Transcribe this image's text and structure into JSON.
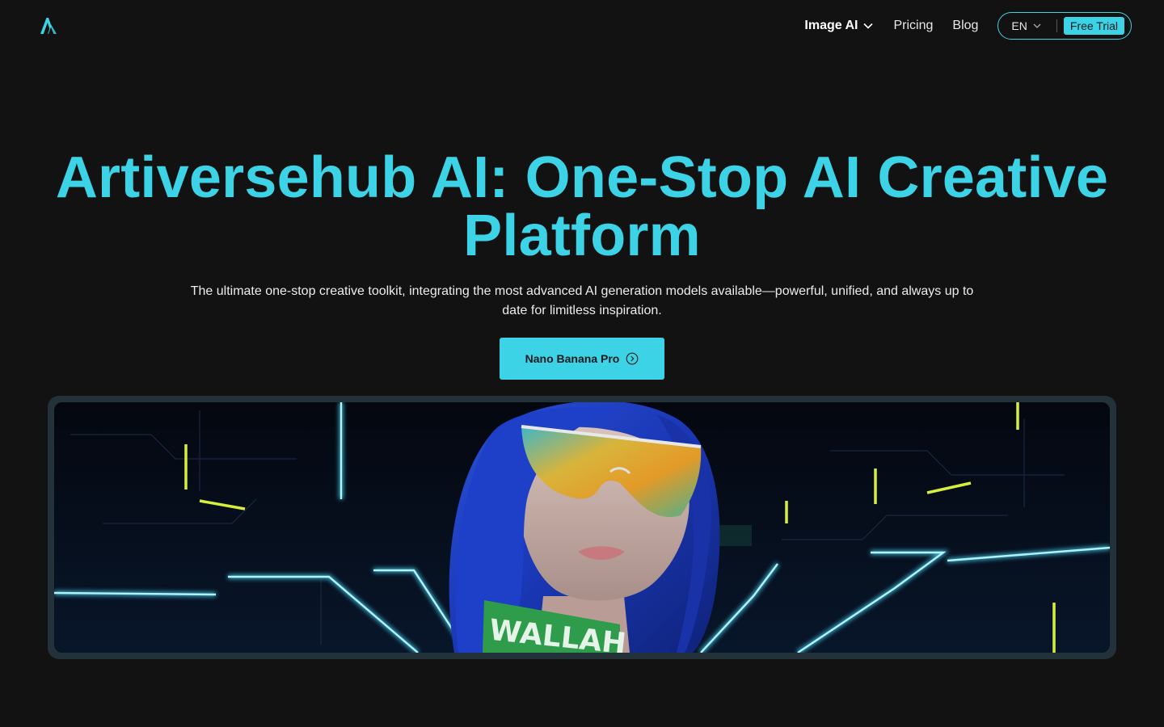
{
  "header": {
    "logo_icon": "artiversehub-logo-icon",
    "nav": {
      "image_ai_label": "Image AI",
      "pricing_label": "Pricing",
      "blog_label": "Blog"
    },
    "language": {
      "selected": "EN"
    },
    "free_trial_label": "Free Trial"
  },
  "hero": {
    "title": "Artiversehub AI: One-Stop AI Creative Platform",
    "subtitle": "The ultimate one-stop creative toolkit, integrating the most advanced AI generation models available—powerful, unified, and always up to date for limitless inspiration.",
    "cta_label": "Nano Banana Pro",
    "cta_icon": "chevron-right-circle-icon"
  },
  "banner": {
    "choker_text": "WALLAH",
    "accent_color": "#3dd3e6"
  },
  "colors": {
    "background": "#121212",
    "accent": "#3dd3e6",
    "banner_frame": "#233238"
  }
}
